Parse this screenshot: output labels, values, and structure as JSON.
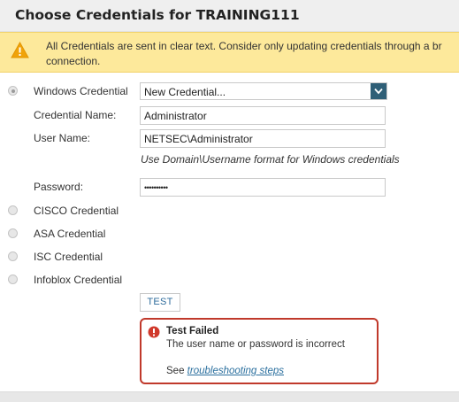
{
  "dialog": {
    "title": "Choose Credentials for TRAINING111"
  },
  "warning": {
    "icon": "warning-icon",
    "text": "All Credentials are sent in clear text. Consider only updating credentials through a br\nconnection."
  },
  "windows": {
    "label": "Windows Credential",
    "selected": true,
    "select_value": "New Credential...",
    "credential_name_label": "Credential Name:",
    "credential_name_value": "Administrator",
    "user_name_label": "User Name:",
    "user_name_value": "NETSEC\\Administrator",
    "hint": "Use Domain\\Username format for Windows credentials",
    "password_label": "Password:",
    "password_value": "••••••••••"
  },
  "other_credentials": {
    "cisco": "CISCO Credential",
    "asa": "ASA Credential",
    "isc": "ISC Credential",
    "infoblox": "Infoblox Credential"
  },
  "test_button": "TEST",
  "error": {
    "title": "Test Failed",
    "message": "The user name or password is incorrect",
    "see_prefix": "See",
    "link_text": "troubleshooting steps"
  },
  "colors": {
    "warning_bg": "#fde99b",
    "error_border": "#c0392b",
    "select_arrow_bg": "#2f5f77",
    "link": "#2a6f9e"
  }
}
